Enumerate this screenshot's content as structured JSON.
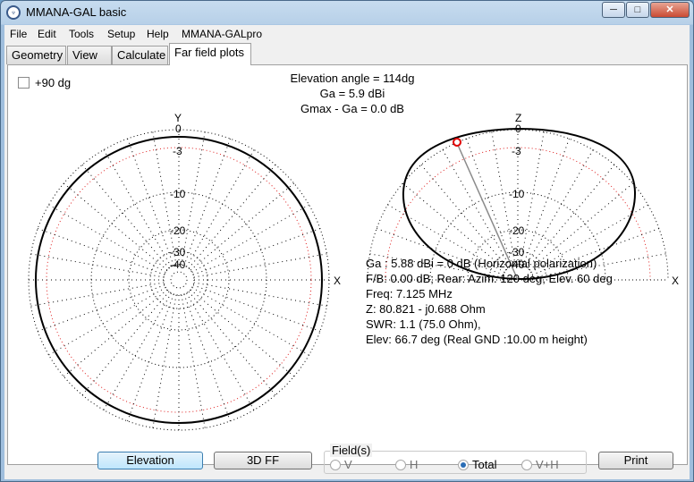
{
  "window": {
    "title": "MMANA-GAL basic",
    "icon": "app-logo-icon",
    "controls": {
      "minimize": "─",
      "maximize": "□",
      "close": "✕"
    }
  },
  "menu": [
    "File",
    "Edit",
    "Tools",
    "Setup",
    "Help",
    "MMANA-GALpro"
  ],
  "tabs": [
    {
      "label": "Geometry",
      "active": false
    },
    {
      "label": "View",
      "active": false
    },
    {
      "label": "Calculate",
      "active": false
    },
    {
      "label": "Far field plots",
      "active": true
    }
  ],
  "plot": {
    "checkbox_label": "+90 dg",
    "checkbox_checked": false,
    "header": {
      "elevation_angle": "Elevation angle = 114dg",
      "ga": "Ga = 5.9 dBi",
      "gmax": "Gmax - Ga = 0.0 dB"
    },
    "azimuth_axis": {
      "top": "Y",
      "right": "X"
    },
    "elevation_axis": {
      "top": "Z",
      "right": "X"
    },
    "ring_labels": [
      "0",
      "-3",
      "-10",
      "-20",
      "-30",
      "-40"
    ],
    "info": [
      "Ga : 5.88 dBi = 0 dB  (Horizontal polarization)",
      "F/B: 0.00 dB; Rear: Azim. 120 deg,  Elev. 60 deg",
      "Freq: 7.125 MHz",
      "Z: 80.821 - j0.688 Ohm",
      "SWR: 1.1 (75.0 Ohm),",
      "Elev: 66.7 deg (Real GND  :10.00 m height)"
    ],
    "colors": {
      "grid": "#000000",
      "minus3_ring": "#e02020",
      "pattern": "#000000",
      "marker": "#e00000"
    }
  },
  "bottom": {
    "elevation_button": "Elevation",
    "ff3d_button": "3D FF",
    "field_legend": "Field(s)",
    "radios": [
      {
        "label": "V",
        "checked": false
      },
      {
        "label": "H",
        "checked": false
      },
      {
        "label": "Total",
        "checked": true
      },
      {
        "label": "V+H",
        "checked": false
      }
    ],
    "print_button": "Print"
  }
}
